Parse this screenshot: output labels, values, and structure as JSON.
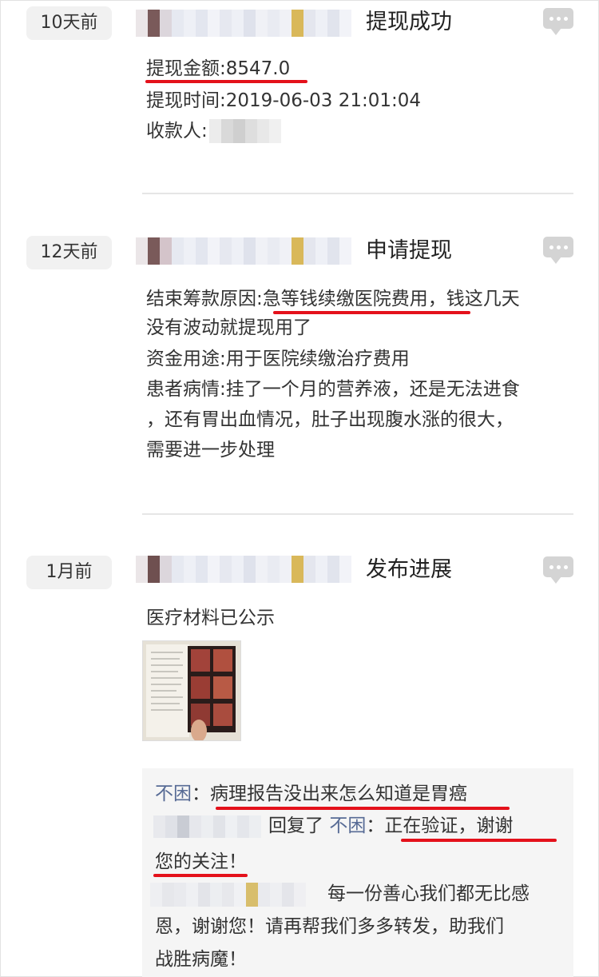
{
  "posts": [
    {
      "time": "10天前",
      "title": "提现成功",
      "lines": [
        "提现金额:8547.0",
        "提现时间:2019-06-03 21:01:04",
        "收款人:"
      ]
    },
    {
      "time": "12天前",
      "title": "申请提现",
      "lines": [
        "结束筹款原因:急等钱续缴医院费用，钱这几天",
        "没有波动就提现用了",
        "资金用途:用于医院续缴治疗费用",
        "患者病情:挂了一个月的营养液，还是无法进食",
        "，还有胃出血情况，肚子出现腹水涨的很大，",
        "需要进一步处理"
      ]
    },
    {
      "time": "1月前",
      "title": "发布进展",
      "lines": [
        "医疗材料已公示"
      ]
    }
  ],
  "comments": {
    "c1_name": "不困",
    "c1_sep": "：",
    "c1_text": "病理报告没出来怎么知道是胃癌",
    "c2_reply": "回复了",
    "c2_target": "不困",
    "c2_sep": "：",
    "c2_text1": "正在验证，谢谢",
    "c2_text2": "您的关注！",
    "c3_text1": "每一份善心我们都无比感",
    "c3_text2": "恩，谢谢您！请再帮我们多多转发，助我们",
    "c3_text3": "战胜病魔！"
  },
  "colors": {
    "accent_red": "#e4111b",
    "name_blue": "#576b95",
    "badge_bg": "#f1f1f1"
  },
  "icons": {
    "comment": "comment-bubble-icon"
  }
}
